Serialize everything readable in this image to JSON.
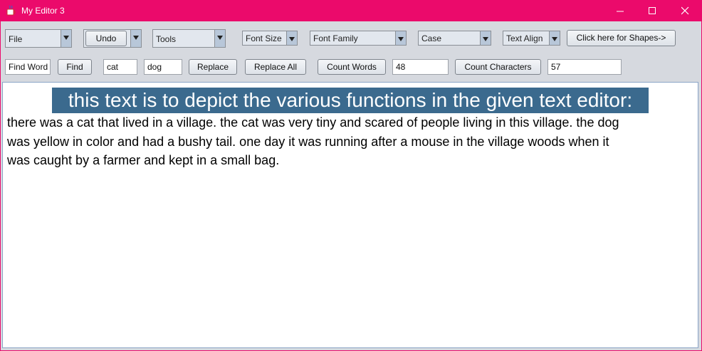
{
  "window": {
    "title": "My Editor 3"
  },
  "toolbar_row1": {
    "file_menu": "File",
    "undo": "Undo",
    "tools_menu": "Tools",
    "font_size": "Font Size",
    "font_family": "Font Family",
    "case": "Case",
    "text_align": "Text Align",
    "shapes_button": "Click here for Shapes->"
  },
  "toolbar_row2": {
    "find_word_field": "Find Word",
    "find_button": "Find",
    "search_term": "cat",
    "replace_term": "dog",
    "replace_button": "Replace",
    "replace_all_button": "Replace All",
    "count_words_button": "Count Words",
    "word_count": "48",
    "count_characters_button": "Count Characters",
    "character_count": "57"
  },
  "document": {
    "heading": "this text is to depict the various functions in the given text editor:",
    "lines": [
      "there was a cat that lived in a village. the cat was very tiny and scared of people living in this village. the dog",
      "was yellow in color and had a bushy tail. one day it was running after a mouse in the village woods when it",
      "was caught by a farmer and kept in a small bag."
    ]
  },
  "colors": {
    "titlebar": "#eb0a6b",
    "toolbar_bg": "#d6d9df",
    "selection_highlight": "#3b6a8e",
    "editor_border": "#8aa5c6"
  }
}
